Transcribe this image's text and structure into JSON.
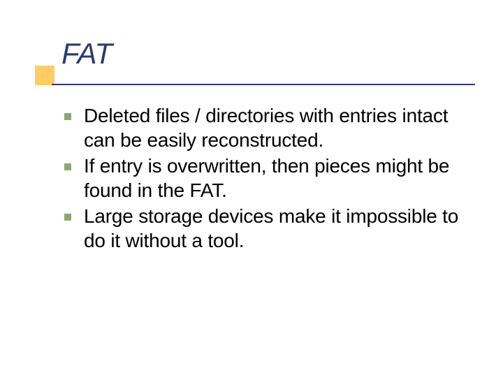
{
  "slide": {
    "title": "FAT",
    "bullets": [
      "Deleted files / directories with entries intact can be easily reconstructed.",
      "If entry is overwritten, then pieces might be found in the FAT.",
      "Large storage devices make it impossible to do it without a tool."
    ],
    "colors": {
      "accent_box": "#ffcc66",
      "title": "#2e3a6a",
      "underline": "#2e3a6a",
      "bullet_marker": "#8ca576",
      "body_text": "#000000"
    }
  }
}
